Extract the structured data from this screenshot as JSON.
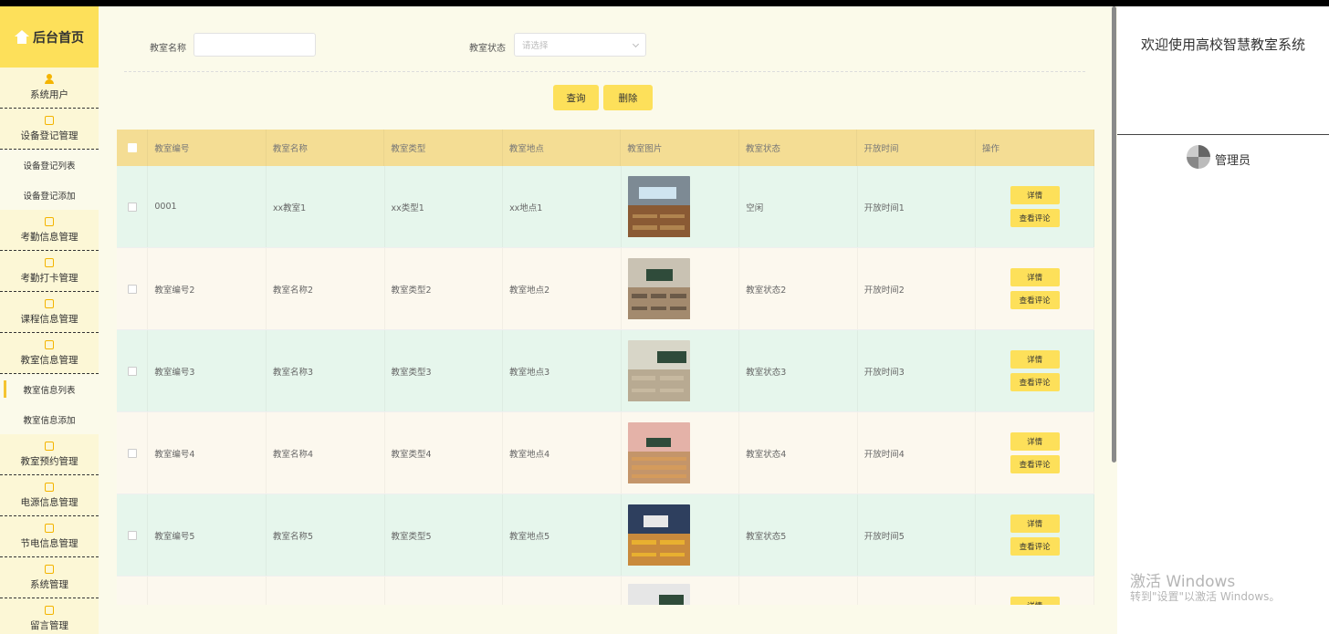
{
  "sidebar": {
    "home_title": "后台首页",
    "menu": [
      {
        "label": "系统用户",
        "icon": "user-icon"
      },
      {
        "label": "设备登记管理",
        "icon": "folder-icon"
      },
      {
        "label": "考勤信息管理",
        "icon": "folder-icon"
      },
      {
        "label": "考勤打卡管理",
        "icon": "folder-icon"
      },
      {
        "label": "课程信息管理",
        "icon": "folder-icon"
      },
      {
        "label": "教室信息管理",
        "icon": "folder-icon"
      },
      {
        "label": "教室预约管理",
        "icon": "folder-icon"
      },
      {
        "label": "电源信息管理",
        "icon": "folder-icon"
      },
      {
        "label": "节电信息管理",
        "icon": "folder-icon"
      },
      {
        "label": "系统管理",
        "icon": "image-icon"
      },
      {
        "label": "留言管理",
        "icon": "image-icon"
      }
    ],
    "sub_device": [
      "设备登记列表",
      "设备登记添加"
    ],
    "sub_classroom": [
      "教室信息列表",
      "教室信息添加"
    ]
  },
  "search": {
    "name_label": "教室名称",
    "name_value": "",
    "status_label": "教室状态",
    "status_placeholder": "请选择",
    "query_button": "查询",
    "delete_button": "删除"
  },
  "table": {
    "headers": [
      "教室编号",
      "教室名称",
      "教室类型",
      "教室地点",
      "教室图片",
      "教室状态",
      "开放时间",
      "操作"
    ],
    "detail_label": "详情",
    "comment_label": "查看评论",
    "rows": [
      {
        "code": "0001",
        "name": "xx教室1",
        "type": "xx类型1",
        "place": "xx地点1",
        "status": "空闲",
        "open": "开放时间1"
      },
      {
        "code": "教室编号2",
        "name": "教室名称2",
        "type": "教室类型2",
        "place": "教室地点2",
        "status": "教室状态2",
        "open": "开放时间2"
      },
      {
        "code": "教室编号3",
        "name": "教室名称3",
        "type": "教室类型3",
        "place": "教室地点3",
        "status": "教室状态3",
        "open": "开放时间3"
      },
      {
        "code": "教室编号4",
        "name": "教室名称4",
        "type": "教室类型4",
        "place": "教室地点4",
        "status": "教室状态4",
        "open": "开放时间4"
      },
      {
        "code": "教室编号5",
        "name": "教室名称5",
        "type": "教室类型5",
        "place": "教室地点5",
        "status": "教室状态5",
        "open": "开放时间5"
      },
      {
        "code": "",
        "name": "",
        "type": "",
        "place": "",
        "status": "",
        "open": ""
      }
    ]
  },
  "right_panel": {
    "welcome": "欢迎使用高校智慧教室系统",
    "user_role": "管理员"
  },
  "watermark": {
    "line1": "激活 Windows",
    "line2": "转到\"设置\"以激活 Windows。"
  },
  "colors": {
    "accent": "#fde05a",
    "header_bg": "#f4dd94",
    "row_green": "#e6f6ec",
    "row_cream": "#fcf8ee",
    "sidebar_bg": "#fcf7d6"
  }
}
